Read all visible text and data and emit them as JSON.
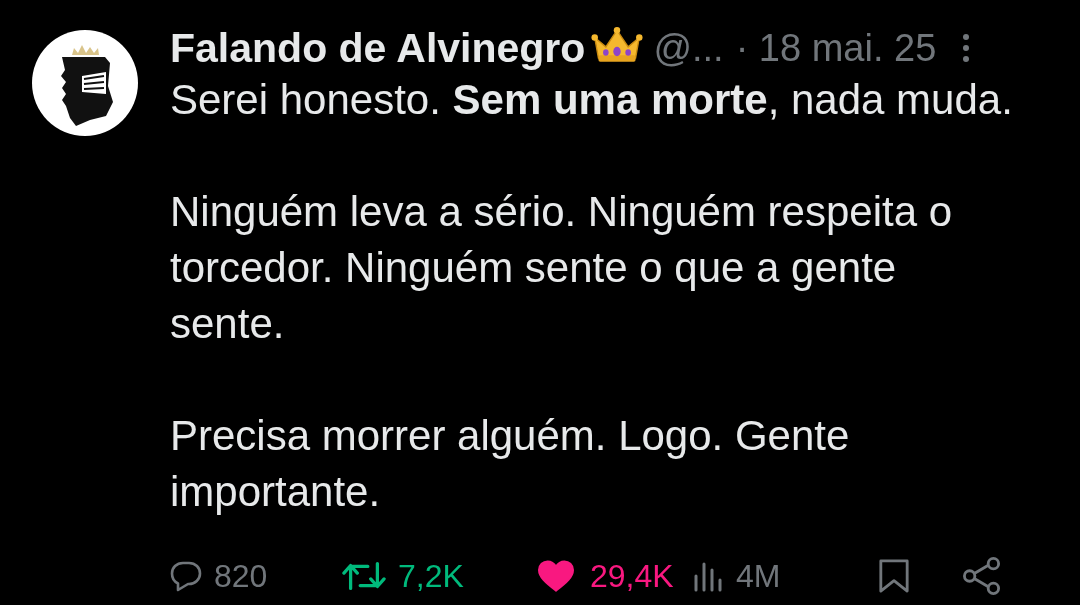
{
  "tweet": {
    "author": {
      "name": "Falando de Alvinegro",
      "handle": "@...",
      "date": "· 18 mai. 25"
    },
    "body": [
      "Serei honesto. **Sem uma morte**, nada muda.",
      "Ninguém leva a sério. Ninguém respeita o torcedor. Ninguém sente o que a gente sente.",
      "Precisa morrer alguém. Logo. Gente importante."
    ],
    "actions": [
      {
        "kind": "reply",
        "count": "820",
        "active": false
      },
      {
        "kind": "retweet",
        "count": "7,2K",
        "active": true
      },
      {
        "kind": "like",
        "count": "29,4K",
        "active": true
      },
      {
        "kind": "views",
        "count": "4M"
      },
      {
        "kind": "bookmark",
        "active": false
      },
      {
        "kind": "share"
      }
    ]
  }
}
